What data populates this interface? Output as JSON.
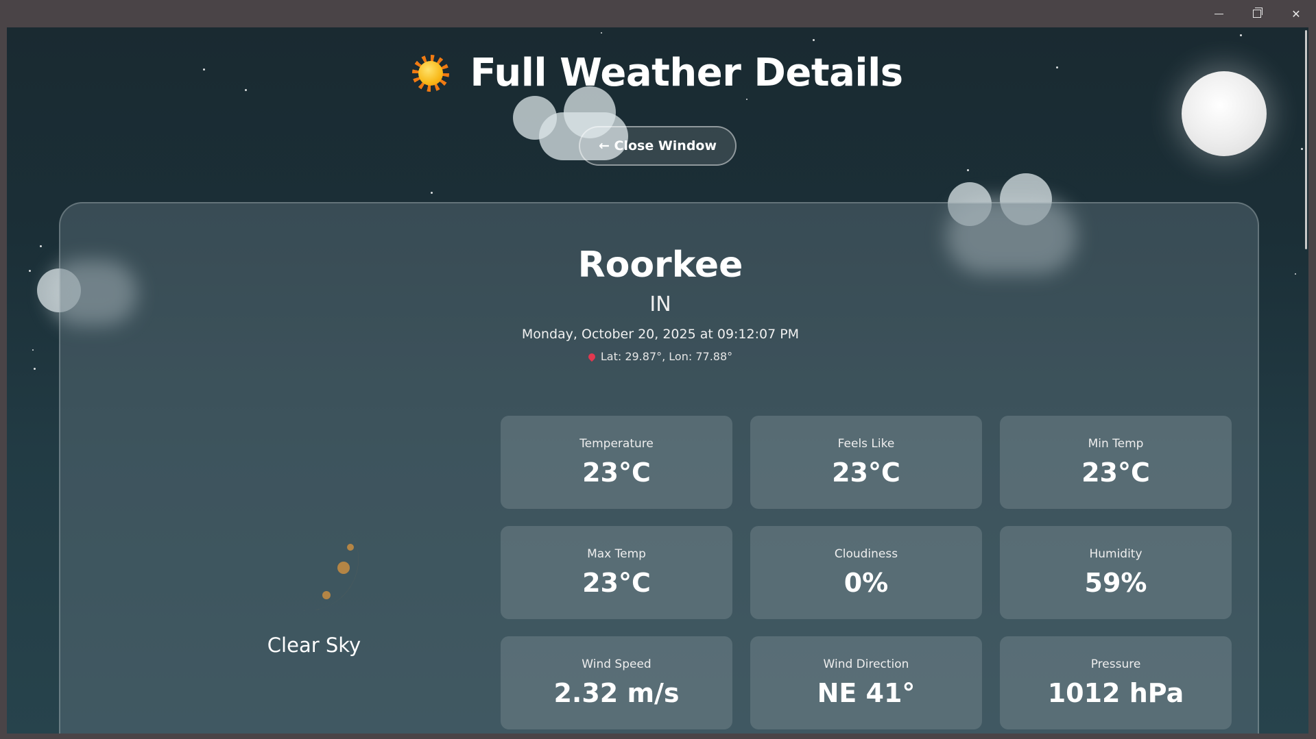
{
  "window": {
    "minimize_icon": "minimize-icon",
    "restore_icon": "restore-icon",
    "close_icon": "close-icon"
  },
  "header": {
    "title": "Full Weather Details",
    "icon": "sun-icon"
  },
  "close_button": {
    "label": "← Close Window"
  },
  "location": {
    "city": "Roorkee",
    "country": "IN",
    "datetime": "Monday, October 20, 2025 at 09:12:07 PM",
    "coords": "Lat: 29.87°, Lon: 77.88°"
  },
  "condition": {
    "icon": "crescent-moon-icon",
    "label": "Clear Sky"
  },
  "stats": [
    {
      "label": "Temperature",
      "value": "23°C"
    },
    {
      "label": "Feels Like",
      "value": "23°C"
    },
    {
      "label": "Min Temp",
      "value": "23°C"
    },
    {
      "label": "Max Temp",
      "value": "23°C"
    },
    {
      "label": "Cloudiness",
      "value": "0%"
    },
    {
      "label": "Humidity",
      "value": "59%"
    },
    {
      "label": "Wind Speed",
      "value": "2.32 m/s"
    },
    {
      "label": "Wind Direction",
      "value": "NE 41°"
    },
    {
      "label": "Pressure",
      "value": "1012 hPa"
    }
  ],
  "colors": {
    "background_top": "#1a2a31",
    "background_bottom": "#27434c",
    "text": "#ffffff"
  }
}
